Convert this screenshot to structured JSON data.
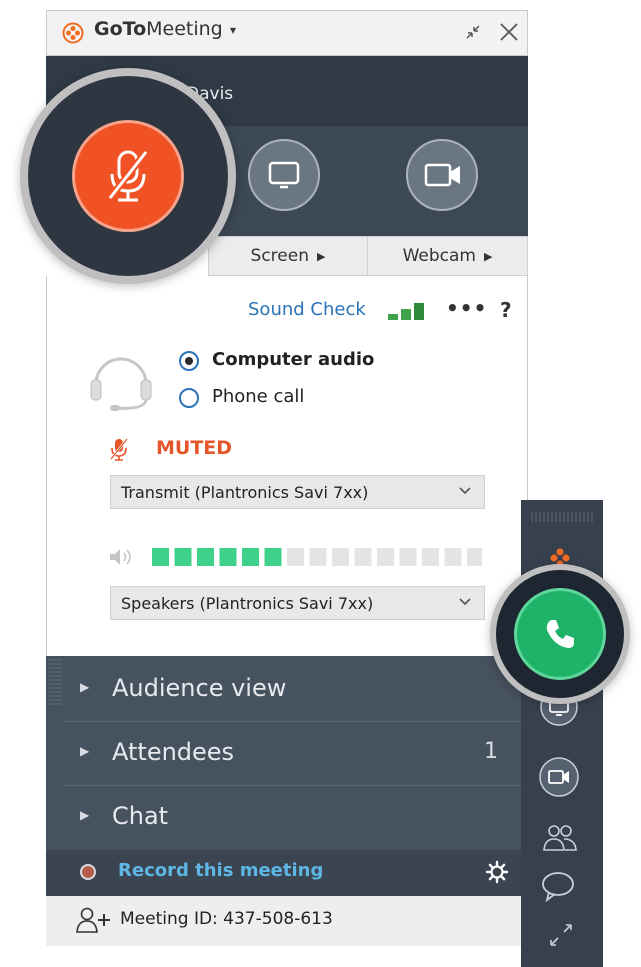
{
  "app": {
    "title_bold": "GoTo",
    "title_rest": "Meeting",
    "caret": "▾",
    "user_name": "Davis"
  },
  "controls": {
    "screen_tab": "Screen",
    "webcam_tab": "Webcam",
    "tab_caret": "▶"
  },
  "audio": {
    "sound_check": "Sound Check",
    "more": "•••",
    "help": "?",
    "options": [
      {
        "label": "Computer audio",
        "selected": true
      },
      {
        "label": "Phone call",
        "selected": false
      }
    ],
    "status": "MUTED",
    "transmit_device": "Transmit (Plantronics Savi 7xx)",
    "speaker_device": "Speakers (Plantronics Savi 7xx)",
    "volume_level_fraction": 0.4
  },
  "sections": {
    "audience_view": "Audience view",
    "attendees": "Attendees",
    "attendees_count": "1",
    "chat": "Chat",
    "collapse_caret": "▶"
  },
  "footer": {
    "record_label": "Record this meeting",
    "meeting_id": "Meeting ID: 437-508-613"
  },
  "icons": {
    "logo": "flower-logo-icon",
    "collapse": "collapse-icon",
    "close": "close-icon",
    "mute_mic": "muted-microphone-icon",
    "screen": "monitor-icon",
    "webcam": "video-camera-icon",
    "signal": "signal-bars-icon",
    "headset": "headset-icon",
    "speaker": "speaker-icon",
    "settings": "gear-icon",
    "add_attendee": "add-person-icon",
    "phone": "phone-icon",
    "attendees": "people-icon",
    "chat": "chat-bubble-icon",
    "expand": "expand-icon"
  },
  "colors": {
    "mute_orange": "#f05125",
    "muted_text": "#e4552a",
    "link_blue": "#2a73b8",
    "call_green": "#1fb36a",
    "meter_green": "#3ed18a",
    "dark_panel": "#47525f"
  }
}
